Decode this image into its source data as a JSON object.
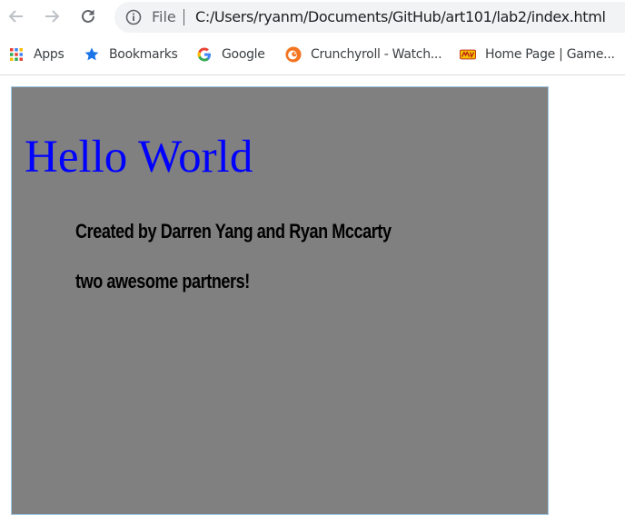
{
  "browser": {
    "location_prefix": "File",
    "url": "C:/Users/ryanm/Documents/GitHub/art101/lab2/index.html",
    "bookmarks": [
      {
        "label": "Apps",
        "icon": "apps-grid-icon"
      },
      {
        "label": "Bookmarks",
        "icon": "star-icon"
      },
      {
        "label": "Google",
        "icon": "google-icon"
      },
      {
        "label": "Crunchyroll - Watch...",
        "icon": "crunchyroll-icon"
      },
      {
        "label": "Home Page | Game...",
        "icon": "gamefaqs-icon"
      }
    ]
  },
  "page": {
    "heading": "Hello World",
    "line1": "Created by Darren Yang and Ryan Mccarty",
    "line2": "two awesome partners!",
    "background_color": "#808080",
    "heading_color": "#0000ff"
  }
}
